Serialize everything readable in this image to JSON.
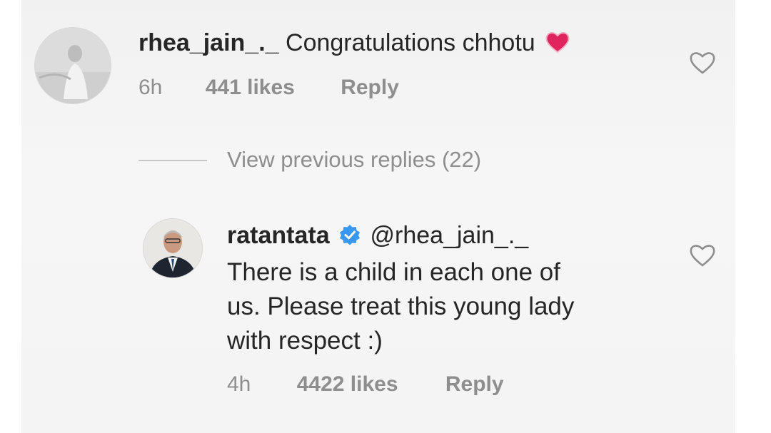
{
  "comments": [
    {
      "username": "rhea_jain_._",
      "text": "Congratulations chhotu",
      "emoji": "heart-emoji",
      "time": "6h",
      "likes": "441 likes",
      "reply_label": "Reply"
    }
  ],
  "view_previous": "View previous replies (22)",
  "replies": [
    {
      "username": "ratantata",
      "verified": true,
      "mention": "@rhea_jain_._",
      "text_lines": [
        "There is a child in each one of",
        "us. Please treat this young lady",
        "with respect :)"
      ],
      "time": "4h",
      "likes": "4422 likes",
      "reply_label": "Reply"
    }
  ],
  "colors": {
    "text": "#262626",
    "secondary": "#8e8e8e",
    "verified": "#3897f0",
    "heart_emoji": "#e0245e"
  }
}
